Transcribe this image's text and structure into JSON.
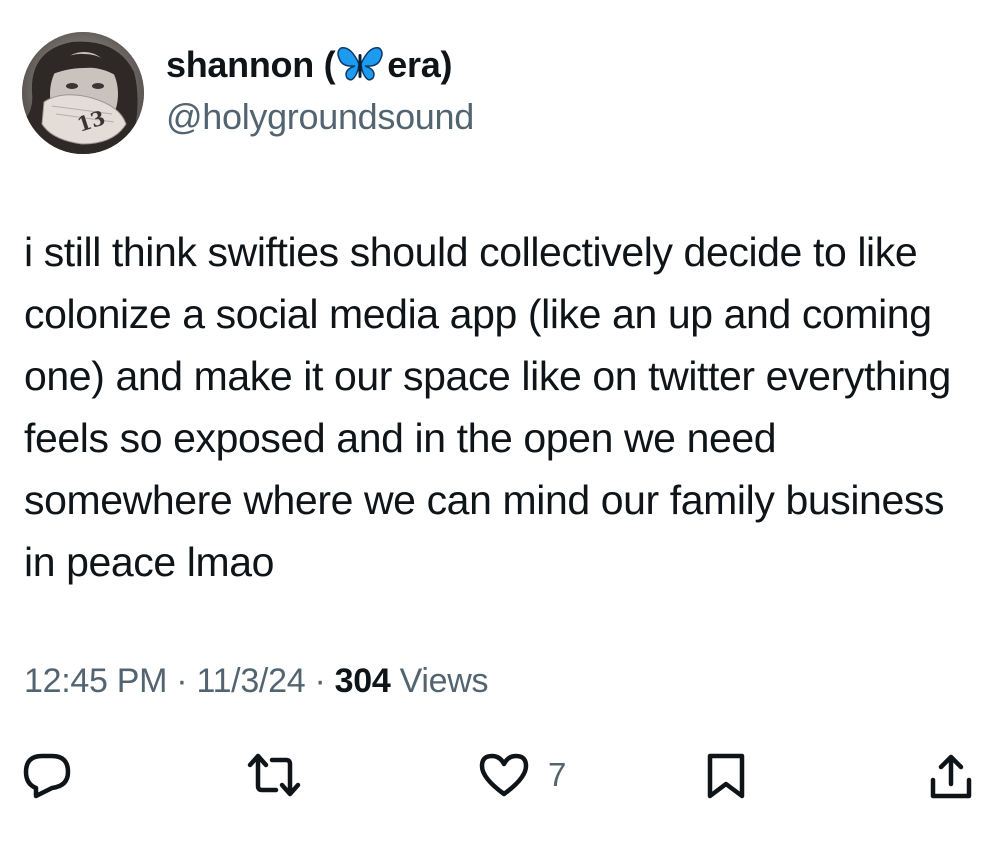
{
  "author": {
    "display_name_before": "shannon (",
    "display_name_emoji": "butterfly-emoji",
    "display_name_after": " era)",
    "handle": "@holygroundsound",
    "avatar_hand_text": "13"
  },
  "tweet": {
    "text": "i still think swifties should collectively decide to like colonize a social media app (like an up and coming one) and make it our space like on twitter everything feels so exposed and in the open we need somewhere where we can mind our family business in peace lmao"
  },
  "meta": {
    "time": "12:45 PM",
    "separator": "·",
    "date": "11/3/24",
    "views_count": "304",
    "views_label": "Views"
  },
  "actions": {
    "reply_icon": "reply-icon",
    "retweet_icon": "retweet-icon",
    "like_icon": "heart-icon",
    "like_count": "7",
    "bookmark_icon": "bookmark-icon",
    "share_icon": "share-icon"
  },
  "colors": {
    "text": "#0f1419",
    "secondary": "#536471",
    "butterfly": "#1d9bf0"
  }
}
